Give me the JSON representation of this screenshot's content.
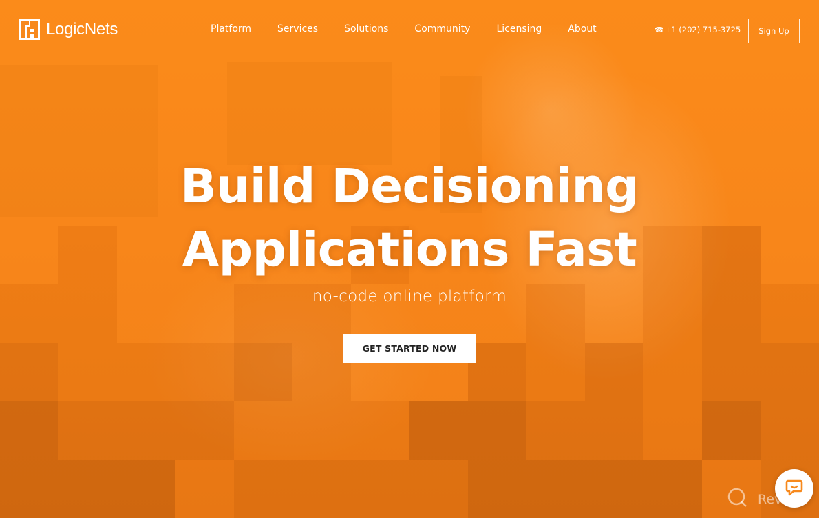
{
  "brand": {
    "name": "LogicNets",
    "accent_color": "#f7891d"
  },
  "nav": {
    "items": [
      {
        "label": "Platform"
      },
      {
        "label": "Services"
      },
      {
        "label": "Solutions"
      },
      {
        "label": "Community"
      },
      {
        "label": "Licensing"
      },
      {
        "label": "About"
      }
    ]
  },
  "header": {
    "phone_icon": "phone-icon",
    "phone": "+1 (202) 715-3725",
    "signup_label": "Sign Up"
  },
  "hero": {
    "title_line1": "Build Decisioning",
    "title_line2": "Applications Fast",
    "subtitle": "no-code online platform",
    "cta_label": "GET STARTED NOW"
  },
  "widgets": {
    "chat_icon": "chat-bubble-icon",
    "watermark_text": "Revain"
  }
}
